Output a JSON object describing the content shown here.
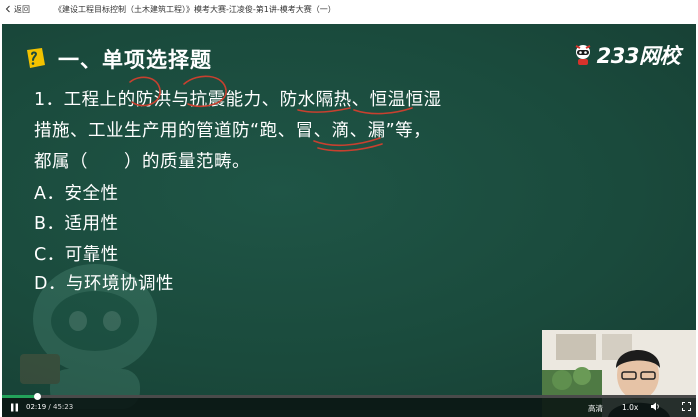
{
  "topbar": {
    "back_label": "返回",
    "breadcrumb": "《建设工程目标控制（土木建筑工程）》模考大赛-江凌俊-第1讲-模考大赛（一）"
  },
  "slide": {
    "section_title": "一、单项选择题",
    "logo_text": "233网校",
    "question_lines": [
      "1．工程上的防洪与抗震能力、防水隔热、恒温恒湿",
      "措施、工业生产用的管道防“跑、冒、滴、漏”等，",
      "都属（　　）的质量范畴。"
    ],
    "options": [
      "A．安全性",
      "B．适用性",
      "C．可靠性",
      "D．与环境协调性"
    ]
  },
  "player": {
    "current_time": "02:19",
    "separator": " / ",
    "total_time": "45:23",
    "progress": 0.051,
    "quality_label": "高清",
    "speed_label": "1.0x"
  },
  "colors": {
    "board": "#1b4a3e",
    "ink": "#c8402f",
    "accent": "#f2c200",
    "progress": "#23a35a"
  }
}
